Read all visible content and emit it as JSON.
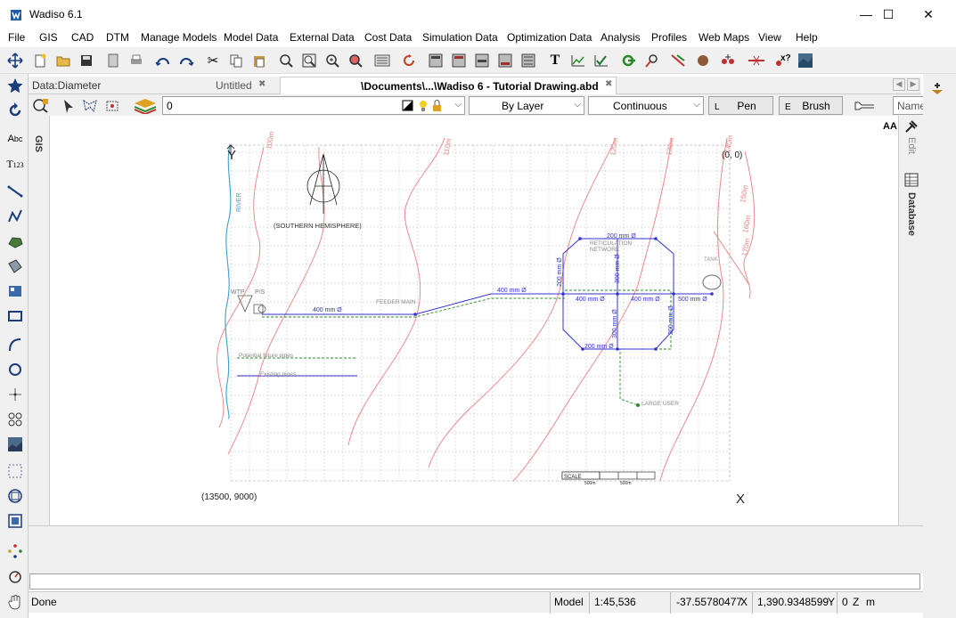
{
  "window": {
    "title": "Wadiso 6.1",
    "minimize": "—",
    "maximize": "☐",
    "close": "✕"
  },
  "menu": [
    "File",
    "GIS",
    "CAD",
    "DTM",
    "Manage Models",
    "Model Data",
    "External Data",
    "Cost Data",
    "Simulation Data",
    "Optimization Data",
    "Analysis",
    "Profiles",
    "Web Maps",
    "View",
    "Help"
  ],
  "tabs": {
    "data_label": "Data:Diameter",
    "untitled": "Untitled",
    "drawing": "\\Documents\\...\\Wadiso 6 - Tutorial Drawing.abd",
    "close": "✖"
  },
  "props": {
    "layer": "0",
    "color": "By Layer",
    "linetype": "Continuous",
    "pen_key": "L",
    "pen": "Pen",
    "brush_key": "E",
    "brush": "Brush",
    "name": "Name"
  },
  "side": {
    "gis": "GIS",
    "edit": "Edit",
    "database": "Database",
    "font_size": "AA"
  },
  "drawing": {
    "y_axis": "Y",
    "x_axis": "X",
    "origin_coord": "(0, 0)",
    "far_coord": "(13500, 9000)",
    "hemisphere": "(SOUTHERN HEMISPHERE)",
    "river": "RIVER",
    "wtp": "WTP",
    "ps": "P/S",
    "tank": "TANK",
    "feeder_main": "FEEDER MAIN",
    "reticulation": "RETICULATION",
    "network": "NETWORK",
    "large_user": "LARGE USER",
    "future_pipes": "Potential future pipes",
    "existing_pipes": "Existing pipes",
    "scale": "SCALE",
    "scale_a": "500m",
    "scale_b": "500m",
    "pipe_400a": "400 mm Ø",
    "pipe_400b": "400 mm Ø",
    "pipe_400c": "400 mm Ø",
    "pipe_400d": "400 mm Ø",
    "pipe_500": "500 mm Ø",
    "pipe_200a": "200 mm Ø",
    "pipe_200b": "200 mm Ø",
    "pipe_200c": "200 mm Ø",
    "pipe_200d": "200 mm Ø",
    "pipe_300a": "300 mm Ø",
    "pipe_300b": "300 mm Ø",
    "contours": [
      "100m",
      "110m",
      "120m",
      "130m",
      "140m",
      "150m",
      "160m",
      "170m",
      "180m"
    ]
  },
  "status": {
    "state": "Done",
    "space": "Model",
    "scale": "1:45,536",
    "x": "-37.55780477",
    "x_lbl": "X",
    "y": "1,390.9348599",
    "y_lbl": "Y",
    "z": "0",
    "z_lbl": "Z",
    "unit": "m"
  },
  "colors": {
    "pipe": "#3333cc",
    "contour": "#e88080",
    "future": "#2a8a2a",
    "river": "#3aa0c8",
    "grid": "#bbbbbb"
  }
}
